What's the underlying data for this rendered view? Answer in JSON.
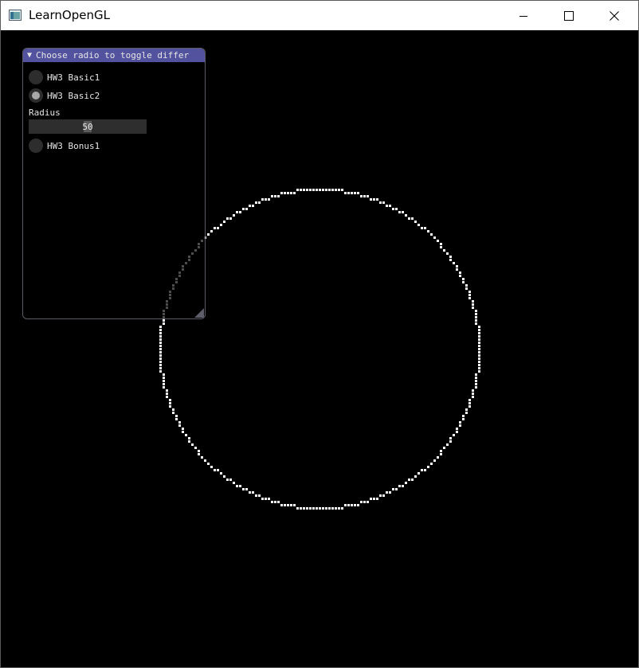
{
  "window": {
    "title": "LearnOpenGL",
    "controls": {
      "minimize_icon": "minimize-icon",
      "maximize_icon": "maximize-icon",
      "close_icon": "close-icon"
    }
  },
  "imgui": {
    "title": "Choose radio to toggle differ",
    "radios": [
      {
        "label": "HW3 Basic1",
        "selected": false
      },
      {
        "label": "HW3 Basic2",
        "selected": true
      },
      {
        "label": "HW3 Bonus1",
        "selected": false
      }
    ],
    "radius_label": "Radius",
    "radius_value": "50",
    "radius_fraction": 0.5,
    "colors": {
      "title_bg": "#52529e",
      "frame_bg": "#2e2e2e",
      "text": "#e6e6e6"
    }
  },
  "scene": {
    "shape": "rasterized circle",
    "radius": 50,
    "color": "#ffffff",
    "background": "#000000"
  }
}
